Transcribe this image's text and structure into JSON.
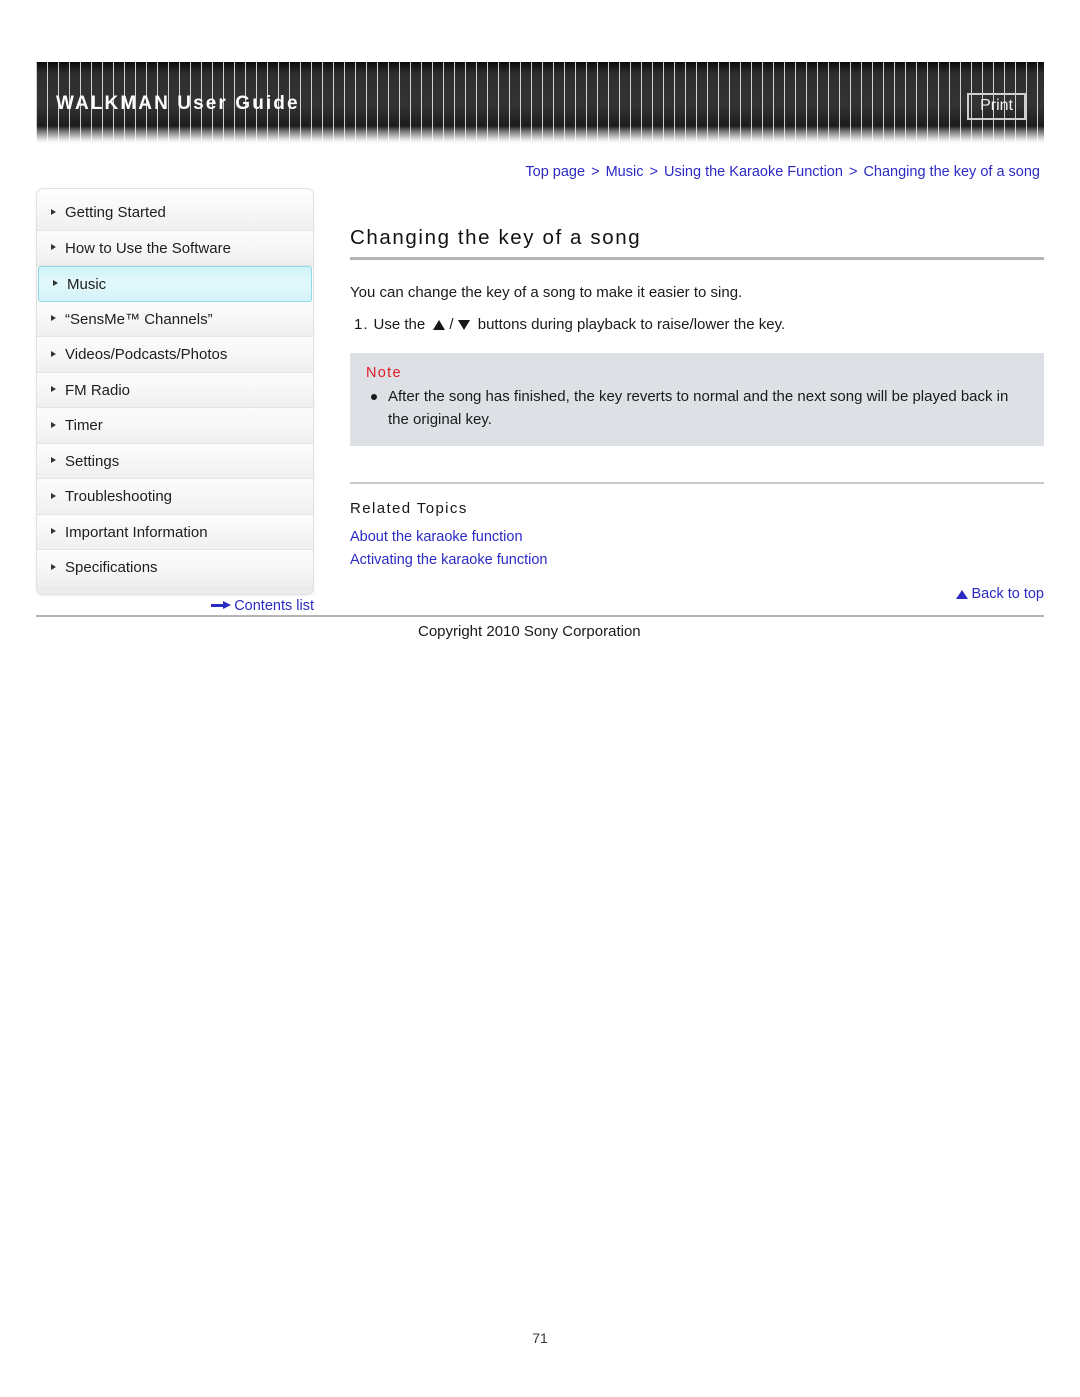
{
  "header": {
    "title": "WALKMAN User Guide",
    "print_label": "Print"
  },
  "breadcrumb": {
    "items": [
      "Top page",
      "Music",
      "Using the Karaoke Function",
      "Changing the key of a song"
    ],
    "separator": ">"
  },
  "sidebar": {
    "items": [
      {
        "label": "Getting Started",
        "active": false
      },
      {
        "label": "How to Use the Software",
        "active": false
      },
      {
        "label": "Music",
        "active": true
      },
      {
        "label": "“SensMe™ Channels”",
        "active": false
      },
      {
        "label": "Videos/Podcasts/Photos",
        "active": false
      },
      {
        "label": "FM Radio",
        "active": false
      },
      {
        "label": "Timer",
        "active": false
      },
      {
        "label": "Settings",
        "active": false
      },
      {
        "label": "Troubleshooting",
        "active": false
      },
      {
        "label": "Important Information",
        "active": false
      },
      {
        "label": "Specifications",
        "active": false
      }
    ],
    "contents_list_label": "Contents list"
  },
  "main": {
    "title": "Changing the key of a song",
    "intro": "You can change the key of a song to make it easier to sing.",
    "step": {
      "number": "1.",
      "text_before": "Use the",
      "slash": "/",
      "text_after": "buttons during playback to raise/lower the key."
    },
    "note": {
      "heading": "Note",
      "items": [
        "After the song has finished, the key reverts to normal and the next song will be played back in the original key."
      ]
    },
    "related": {
      "heading": "Related Topics",
      "links": [
        "About the karaoke function",
        "Activating the karaoke function"
      ]
    },
    "back_to_top_label": "Back to top"
  },
  "footer": {
    "copyright": "Copyright 2010 Sony Corporation",
    "page_number": "71"
  },
  "colors": {
    "link": "#2b2bc4",
    "note_heading": "#e01b24",
    "active_nav": "#cdf2f8",
    "note_bg": "#dde0e4"
  }
}
